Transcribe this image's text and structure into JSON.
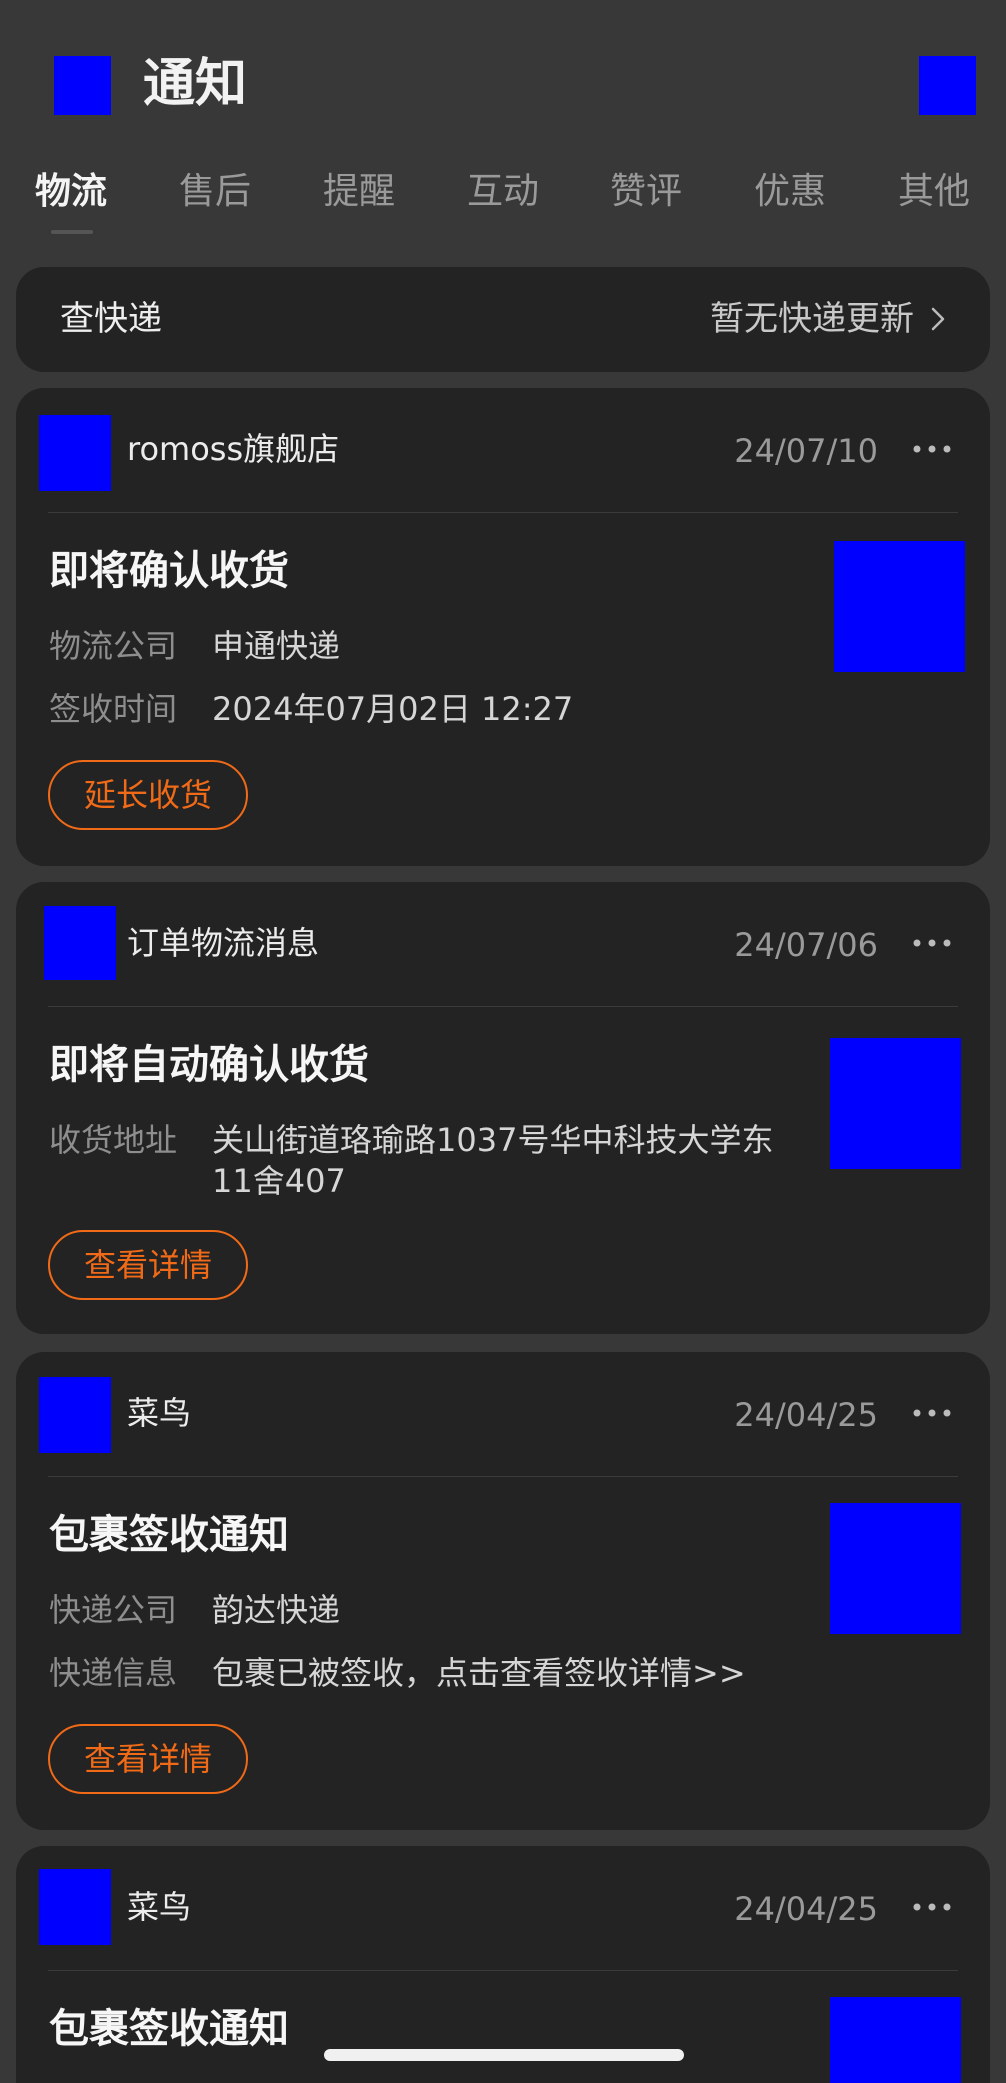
{
  "header": {
    "title": "通知",
    "left_icon": "app-icon",
    "right_icon": "settings-icon"
  },
  "tabs": [
    "物流",
    "售后",
    "提醒",
    "互动",
    "赞评",
    "优惠",
    "其他"
  ],
  "active_tab": "物流",
  "express_bar": {
    "label": "查快递",
    "status": "暂无快递更新"
  },
  "accent_color": "#f06a17",
  "cards": [
    {
      "sender": "romoss旗舰店",
      "date": "24/07/10",
      "title": "即将确认收货",
      "fields": [
        {
          "label": "物流公司",
          "value": "申通快递"
        },
        {
          "label": "签收时间",
          "value": "2024年07月02日 12:27"
        }
      ],
      "action": "延长收货"
    },
    {
      "sender": "订单物流消息",
      "date": "24/07/06",
      "title": "即将自动确认收货",
      "fields": [
        {
          "label": "收货地址",
          "value": "关山街道珞瑜路1037号华中科技大学东",
          "value_line2": "11舍407"
        }
      ],
      "action": "查看详情"
    },
    {
      "sender": "菜鸟",
      "date": "24/04/25",
      "title": "包裹签收通知",
      "fields": [
        {
          "label": "快递公司",
          "value": "韵达快递"
        },
        {
          "label": "快递信息",
          "value": "包裹已被签收，点击查看签收详情>>"
        }
      ],
      "action": "查看详情"
    },
    {
      "sender": "菜鸟",
      "date": "24/04/25",
      "title": "包裹签收通知"
    }
  ]
}
